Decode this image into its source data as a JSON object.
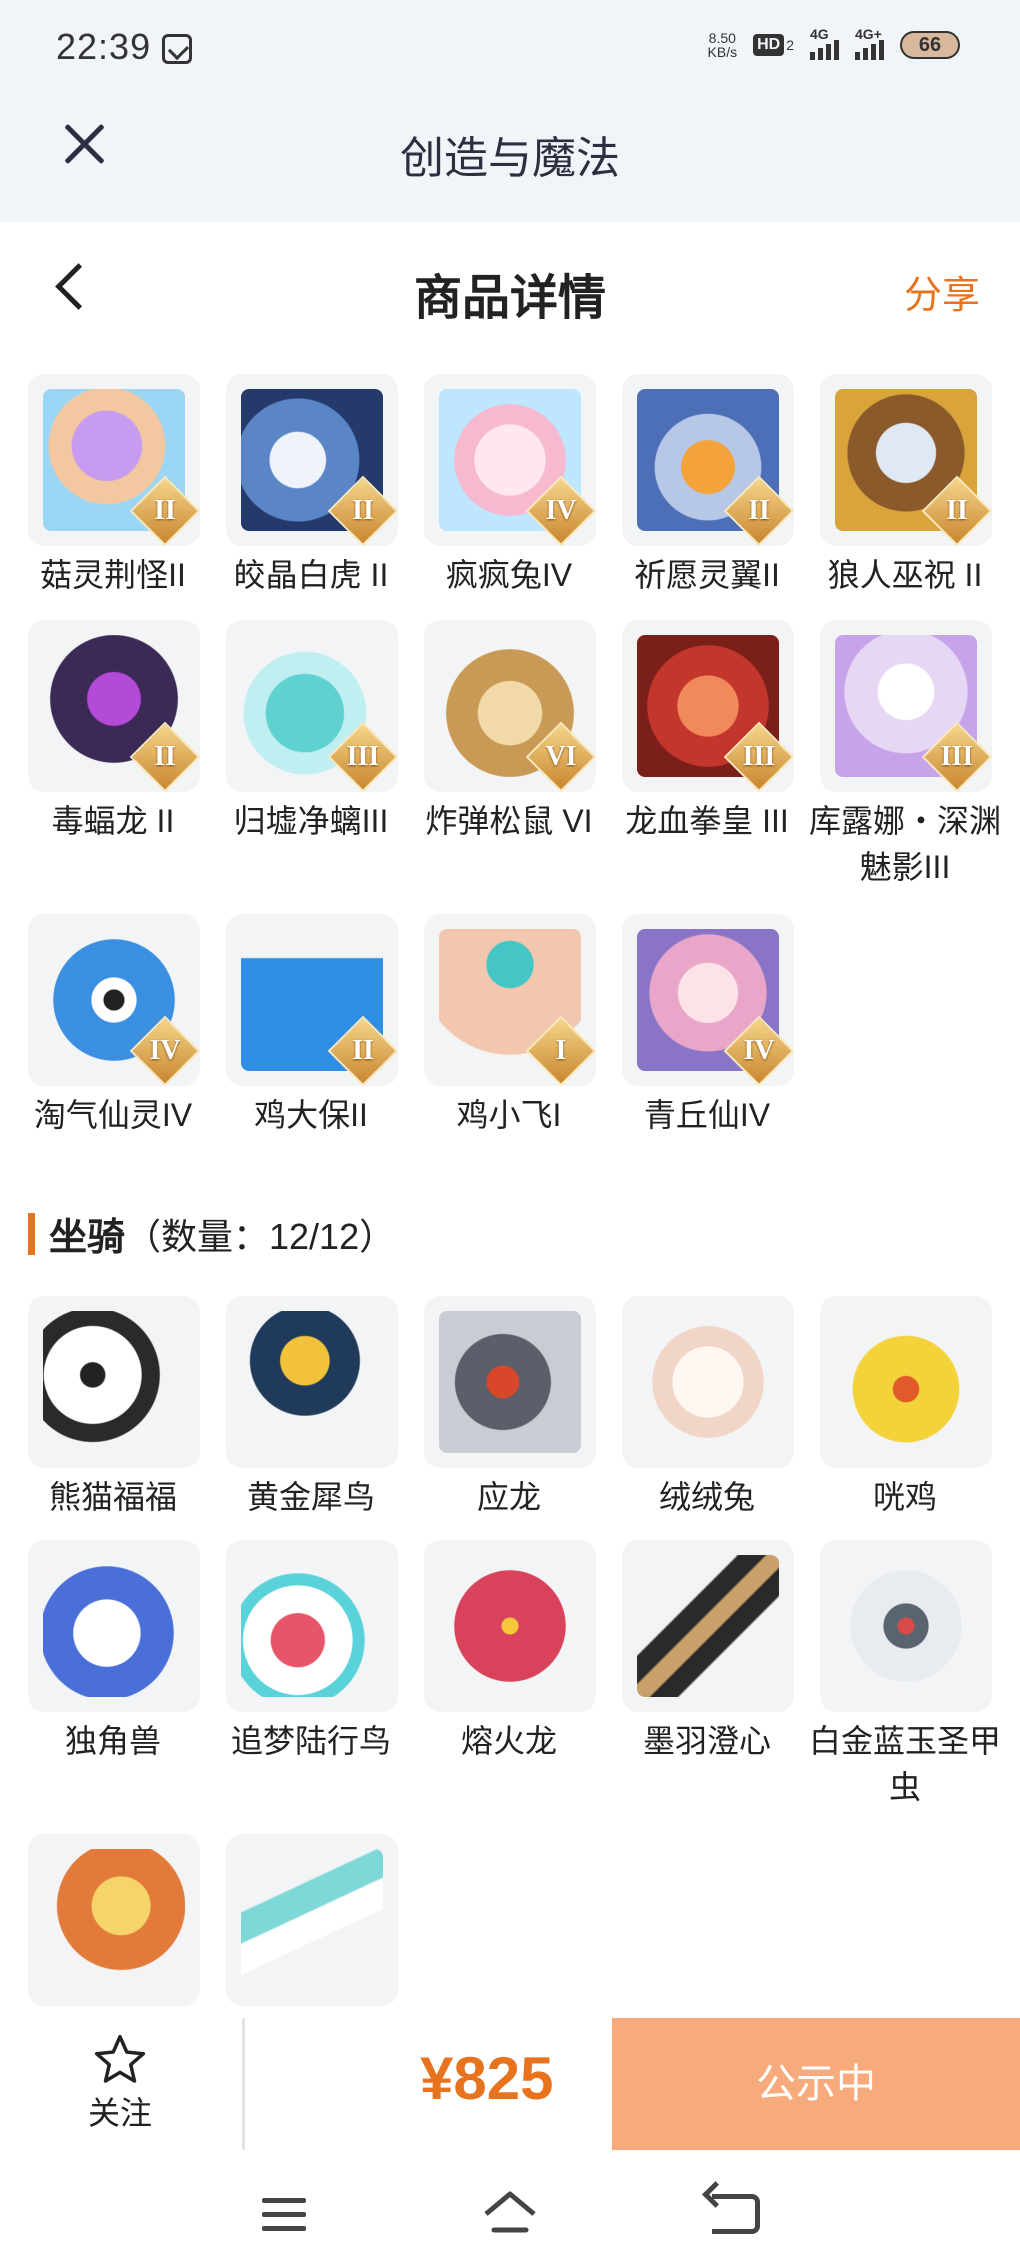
{
  "status_bar": {
    "time": "22:39",
    "net_speed_value": "8.50",
    "net_speed_unit": "KB/s",
    "hd_label": "HD",
    "hd_sub": "2",
    "signal1": "4G",
    "signal2": "4G+",
    "battery": "66"
  },
  "app_bar": {
    "title": "创造与魔法",
    "close_icon": "close-icon"
  },
  "header": {
    "title": "商品详情",
    "share": "分享",
    "back_icon": "chevron-left-icon"
  },
  "items_top": [
    {
      "name": "菇灵荆怪II",
      "tier": "II"
    },
    {
      "name": "皎晶白虎 II",
      "tier": "II"
    },
    {
      "name": "疯疯兔IV",
      "tier": "IV"
    },
    {
      "name": "祈愿灵翼II",
      "tier": "II"
    },
    {
      "name": "狼人巫祝 II",
      "tier": "II"
    },
    {
      "name": "毒蝠龙 II",
      "tier": "II"
    },
    {
      "name": "归墟净螭III",
      "tier": "III"
    },
    {
      "name": "炸弹松鼠 VI",
      "tier": "VI"
    },
    {
      "name": "龙血拳皇 III",
      "tier": "III"
    },
    {
      "name": "库露娜・深渊魅影III",
      "tier": "III"
    },
    {
      "name": "淘气仙灵IV",
      "tier": "IV"
    },
    {
      "name": "鸡大保II",
      "tier": "II"
    },
    {
      "name": "鸡小飞I",
      "tier": "I"
    },
    {
      "name": "青丘仙IV",
      "tier": "IV"
    }
  ],
  "mounts_section": {
    "title": "坐骑",
    "count": "（数量：12/12）"
  },
  "mounts": [
    {
      "name": "熊猫福福"
    },
    {
      "name": "黄金犀鸟"
    },
    {
      "name": "应龙"
    },
    {
      "name": "绒绒兔"
    },
    {
      "name": "咣鸡"
    },
    {
      "name": "独角兽"
    },
    {
      "name": "追梦陆行鸟"
    },
    {
      "name": "熔火龙"
    },
    {
      "name": "墨羽澄心"
    },
    {
      "name": "白金蓝玉圣甲虫"
    },
    {
      "name": ""
    },
    {
      "name": ""
    }
  ],
  "bottom_bar": {
    "follow": "关注",
    "price": "¥825",
    "status": "公示中"
  },
  "colors": {
    "accent": "#e8731f",
    "status_button": "#f7aa7c"
  }
}
